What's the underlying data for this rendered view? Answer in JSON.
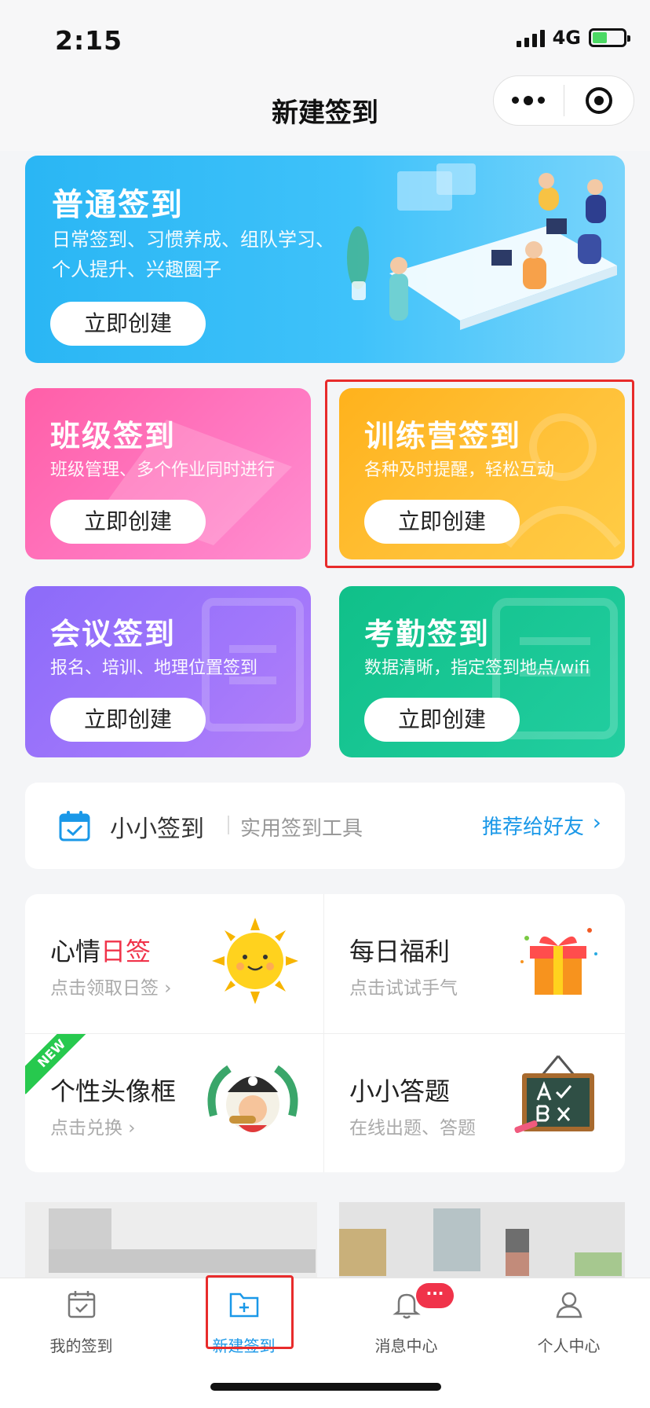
{
  "status": {
    "time": "2:15",
    "network": "4G"
  },
  "header": {
    "title": "新建签到"
  },
  "cards": {
    "main": {
      "title": "普通签到",
      "desc1": "日常签到、习惯养成、组队学习、",
      "desc2": "个人提升、兴趣圈子",
      "button": "立即创建"
    },
    "class": {
      "title": "班级签到",
      "desc": "班级管理、多个作业同时进行",
      "button": "立即创建"
    },
    "camp": {
      "title": "训练营签到",
      "desc": "各种及时提醒，轻松互动",
      "button": "立即创建"
    },
    "meeting": {
      "title": "会议签到",
      "desc": "报名、培训、地理位置签到",
      "button": "立即创建"
    },
    "attendance": {
      "title": "考勤签到",
      "desc": "数据清晰，指定签到地点/wifi",
      "button": "立即创建"
    }
  },
  "promo": {
    "name": "小小签到",
    "sub": "实用签到工具",
    "recommend": "推荐给好友",
    "arrow": "›"
  },
  "features": {
    "mood": {
      "title_a": "心情",
      "title_b": "日签",
      "desc": "点击领取日签 ›"
    },
    "welfare": {
      "title": "每日福利",
      "desc": "点击试试手气"
    },
    "avatar": {
      "badge": "NEW",
      "title": "个性头像框",
      "desc": "点击兑换 ›"
    },
    "quiz": {
      "title": "小小答题",
      "desc": "在线出题、答题"
    }
  },
  "tabs": [
    {
      "label": "我的签到",
      "icon": "calendar-check-icon"
    },
    {
      "label": "新建签到",
      "icon": "folder-add-icon"
    },
    {
      "label": "消息中心",
      "icon": "bell-icon",
      "badge": "···"
    },
    {
      "label": "个人中心",
      "icon": "person-icon"
    }
  ],
  "colors": {
    "accent": "#1a98e8",
    "highlight": "#e82b2b",
    "badge": "#f0334a"
  }
}
